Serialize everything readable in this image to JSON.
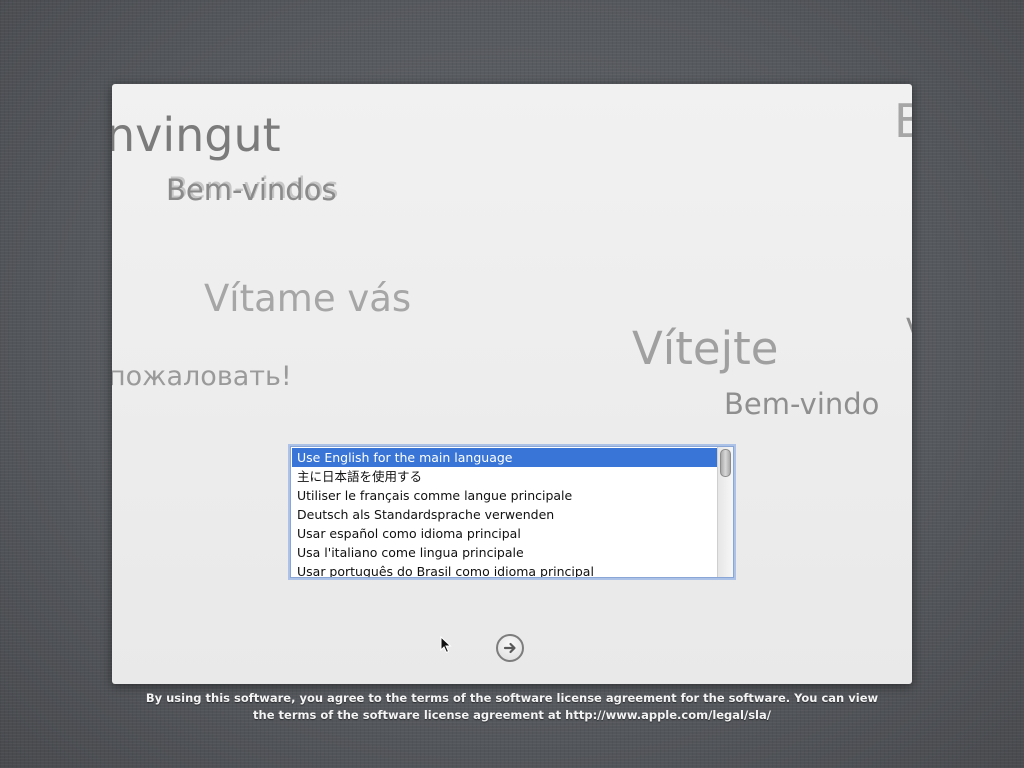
{
  "welcome_words": [
    "nvingut",
    "Bem-vindos",
    "Vítame vás",
    "Vítejte",
    "пожаловать!",
    "Bem-vindo",
    "B",
    "V"
  ],
  "language_list": {
    "items": [
      "Use English for the main language",
      "主に日本語を使用する",
      "Utiliser le français comme langue principale",
      "Deutsch als Standardsprache verwenden",
      "Usar español como idioma principal",
      "Usa l'italiano come lingua principale",
      "Usar português do Brasil como idioma principal"
    ],
    "selected_index": 0
  },
  "continue_button": {
    "icon": "arrow-right-icon"
  },
  "license": {
    "line1": "By using this software, you agree to the terms of the software license agreement for the software. You can view",
    "line2": "the terms of the software license agreement at http://www.apple.com/legal/sla/"
  },
  "colors": {
    "selection": "#3875d7",
    "focus_ring": "#8aa6d6",
    "desktop": "#55585d"
  }
}
